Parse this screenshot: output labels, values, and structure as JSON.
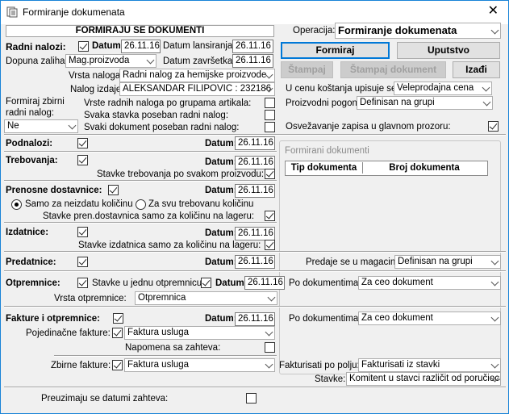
{
  "window": {
    "title": "Formiranje dokumenata",
    "close": "✕"
  },
  "header": {
    "caption": "FORMIRAJU SE DOKUMENTI"
  },
  "operacija": {
    "label": "Operacija:",
    "value": "Formiranje dokumenata"
  },
  "buttons": {
    "formiraj": "Formiraj",
    "uputstvo": "Uputstvo",
    "stampaj": "Štampaj",
    "stampaj_dokument": "Štampaj dokument",
    "izadji": "Izađi"
  },
  "radni": {
    "label": "Radni nalozi:",
    "datum_label": "Datum:",
    "datum": "26.11.16",
    "lans_label": "Datum lansiranja:",
    "lans": "26.11.16",
    "dopuna_label": "Dopuna zaliha:",
    "dopuna": "Mag.proizvoda",
    "zavr_label": "Datum završetka:",
    "zavr": "26.11.16",
    "vrsta_label": "Vrsta naloga:",
    "vrsta": "Radni nalog za hemijske proizvode",
    "nalog_label": "Nalog izdaje:",
    "nalog": "ALEKSANDAR FILIPOVIC : 232186",
    "zbirni_label1": "Formiraj zbirni",
    "zbirni_label2": "radni nalog:",
    "zbirni": "Ne",
    "grupe_label": "Vrste radnih naloga po grupama artikala:",
    "stavka_label": "Svaka stavka poseban radni nalog:",
    "svaki_label": "Svaki dokument poseban radni nalog:"
  },
  "right": {
    "cena_label": "U cenu koštanja upisuje se:",
    "cena": "Veleprodajna cena",
    "pogon_label": "Proizvodni pogon:",
    "pogon": "Definisan na grupi",
    "osvez_label": "Osvežavanje zapisa u glavnom prozoru:"
  },
  "podnalozi": {
    "label": "Podnalozi:",
    "datum_label": "Datum:",
    "datum": "26.11.16"
  },
  "trebovanja": {
    "label": "Trebovanja:",
    "datum_label": "Datum:",
    "datum": "26.11.16",
    "stavke_label": "Stavke trebovanja po svakom proizvodu:"
  },
  "formirani": {
    "title": "Formirani dokumenti",
    "col1": "Tip dokumenta",
    "col2": "Broj dokumenta"
  },
  "prenosne": {
    "label": "Prenosne dostavnice:",
    "datum_label": "Datum:",
    "datum": "26.11.16",
    "opt1": "Samo za neizdatu količinu",
    "opt2": "Za svu trebovanu količinu",
    "stavke_label": "Stavke pren.dostavnica samo za količinu na lageru:"
  },
  "izdatnice": {
    "label": "Izdatnice:",
    "datum_label": "Datum:",
    "datum": "26.11.16",
    "stavke_label": "Stavke izdatnica samo za količinu na lageru:"
  },
  "predatnice": {
    "label": "Predatnice:",
    "datum_label": "Datum:",
    "datum": "26.11.16",
    "magacin_label": "Predaje se u magacin:",
    "magacin": "Definisan na grupi"
  },
  "otpremnice": {
    "label": "Otpremnice:",
    "jedna_label": "Stavke u jednu otpremnicu",
    "datum_label": "Datum:",
    "datum": "26.11.16",
    "podok_label": "Po dokumentima:",
    "podok": "Za ceo dokument",
    "vrsta_label": "Vrsta otpremnice:",
    "vrsta": "Otpremnica"
  },
  "fakture": {
    "label": "Fakture i otpremnice:",
    "datum_label": "Datum:",
    "datum": "26.11.16",
    "podok_label": "Po dokumentima:",
    "podok": "Za ceo dokument",
    "pojed_label": "Pojedinačne fakture:",
    "pojed": "Faktura usluga",
    "napomena_label": "Napomena sa zahteva:",
    "zbirne_label": "Zbirne fakture:",
    "zbirne": "Faktura usluga",
    "polje_label": "Fakturisati po polju:",
    "polje": "Fakturisati iz stavki",
    "stavke_label": "Stavke:",
    "stavke": "Komitent u stavci različit od poručioca"
  },
  "preuzimaju": {
    "label": "Preuzimaju se datumi zahteva:"
  }
}
